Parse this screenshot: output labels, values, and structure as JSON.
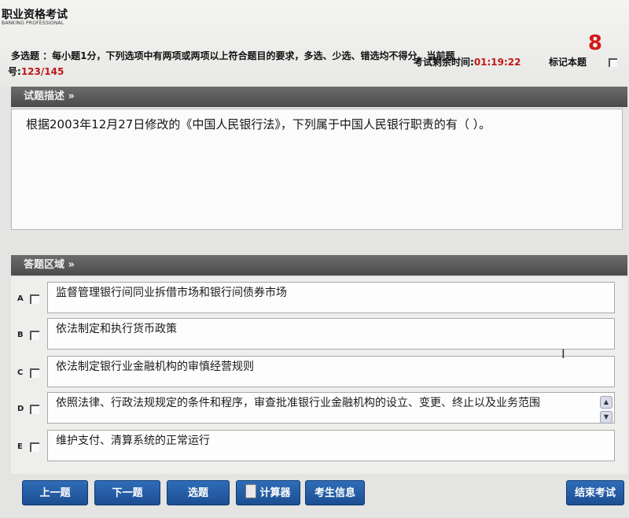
{
  "header": {
    "logo_title": "职业资格考试",
    "logo_sub": "BANKING PROFESSIONAL",
    "instruction_line1": "多选题 ：每小题1分，下列选项中有两项或两项以上符合题目的要求，多选、少选、错选均不得分。当前题",
    "instruction_prefix": "号:",
    "current_question": "123/145",
    "time_label": "考试剩余时间:",
    "time_remaining": "01:19:22",
    "mark_label": "标记本题",
    "big_number": "8"
  },
  "sections": {
    "question_title": "试题描述 »",
    "answer_title": "答题区域 »"
  },
  "question": {
    "text": "根据2003年12月27日修改的《中国人民银行法》，下列属于中国人民银行职责的有（ ）。"
  },
  "options": [
    {
      "letter": "A",
      "text": "监督管理银行间同业拆借市场和银行间债券市场"
    },
    {
      "letter": "B",
      "text": "依法制定和执行货币政策"
    },
    {
      "letter": "C",
      "text": "依法制定银行业金融机构的审慎经营规则"
    },
    {
      "letter": "D",
      "text": "依照法律、行政法规规定的条件和程序，审查批准银行业金融机构的设立、变更、终止以及业务范围"
    },
    {
      "letter": "E",
      "text": "维护支付、清算系统的正常运行"
    }
  ],
  "footer": {
    "prev": "上一题",
    "next": "下一题",
    "choose": "选题",
    "calculator": "计算器",
    "candidate_info": "考生信息",
    "finish": "结束考试"
  },
  "colors": {
    "accent_red": "#c01818",
    "button_blue": "#1c4e92",
    "section_bar": "#555555"
  }
}
